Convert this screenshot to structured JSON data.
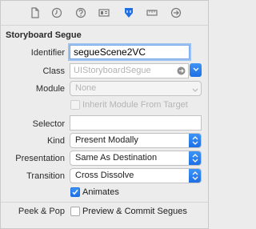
{
  "tabs": [
    {
      "icon": "file-icon"
    },
    {
      "icon": "clock-icon"
    },
    {
      "icon": "help-icon"
    },
    {
      "icon": "identity-card-icon"
    },
    {
      "icon": "attributes-shield-icon",
      "selected": true
    },
    {
      "icon": "ruler-icon"
    },
    {
      "icon": "connections-arrow-icon"
    }
  ],
  "segue": {
    "section_title": "Storyboard Segue",
    "identifier": {
      "label": "Identifier",
      "value": "segueScene2VC"
    },
    "class": {
      "label": "Class",
      "placeholder": "UIStoryboardSegue"
    },
    "module": {
      "label": "Module",
      "placeholder": "None"
    },
    "inherit_module": {
      "label": "Inherit Module From Target",
      "checked": false
    },
    "selector": {
      "label": "Selector",
      "value": ""
    },
    "kind": {
      "label": "Kind",
      "value": "Present Modally"
    },
    "presentation": {
      "label": "Presentation",
      "value": "Same As Destination"
    },
    "transition": {
      "label": "Transition",
      "value": "Cross Dissolve"
    },
    "animates": {
      "label": "Animates",
      "checked": true
    }
  },
  "peek_pop": {
    "label": "Peek & Pop",
    "preview_label": "Preview & Commit Segues",
    "checked": false
  },
  "colors": {
    "accent": "#1e6fe5",
    "panel": "#ececec"
  }
}
